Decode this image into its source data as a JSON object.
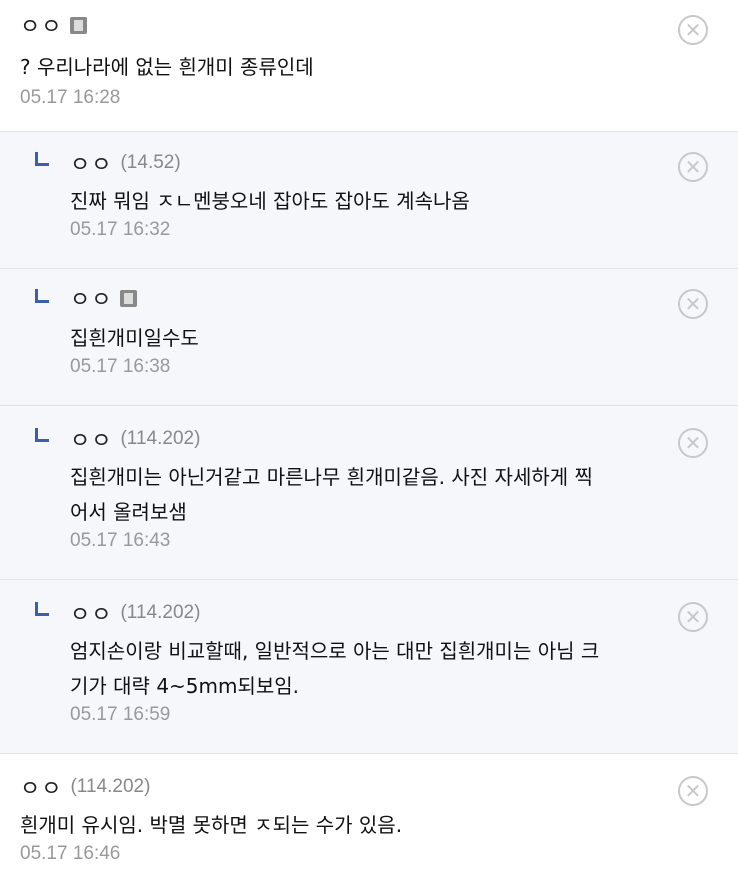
{
  "comments": [
    {
      "nick": "ㅇㅇ",
      "ip": "",
      "badge": true,
      "text": "? 우리나라에 없는 흰개미 종류인데",
      "date": "05.17 16:28",
      "reply": false
    },
    {
      "nick": "ㅇㅇ",
      "ip": "(14.52)",
      "badge": false,
      "text": "진짜 뭐임 ㅈㄴ멘붕오네 잡아도 잡아도 계속나옴",
      "date": "05.17 16:32",
      "reply": true
    },
    {
      "nick": "ㅇㅇ",
      "ip": "",
      "badge": true,
      "text": "집흰개미일수도",
      "date": "05.17 16:38",
      "reply": true
    },
    {
      "nick": "ㅇㅇ",
      "ip": "(114.202)",
      "badge": false,
      "text": "집흰개미는 아닌거같고 마른나무 흰개미같음. 사진 자세하게 찍\n어서 올려보샘",
      "date": "05.17 16:43",
      "reply": true
    },
    {
      "nick": "ㅇㅇ",
      "ip": "(114.202)",
      "badge": false,
      "text": "엄지손이랑 비교할때, 일반적으로 아는 대만 집흰개미는 아님 크\n기가 대략 4~5mm되보임.",
      "date": "05.17 16:59",
      "reply": true
    },
    {
      "nick": "ㅇㅇ",
      "ip": "(114.202)",
      "badge": false,
      "text": "흰개미 유시임. 박멸 못하면 ㅈ되는 수가 있음.",
      "date": "05.17 16:46",
      "reply": false
    }
  ],
  "delete_symbol": "✕"
}
